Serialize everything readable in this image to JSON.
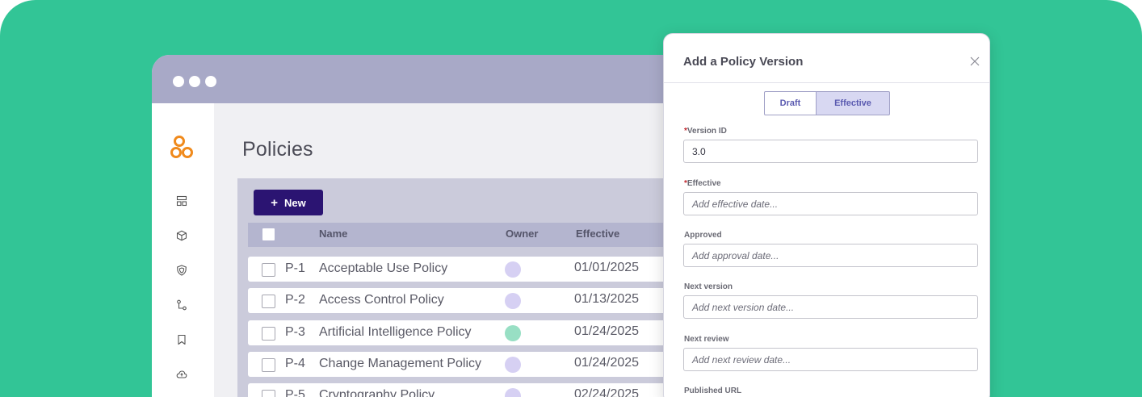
{
  "app": {
    "page_title": "Policies",
    "new_button_label": "New",
    "new_button_icon": "plus-icon"
  },
  "sidebar": {
    "items": [
      {
        "icon": "dashboard-icon"
      },
      {
        "icon": "cube-icon"
      },
      {
        "icon": "shield-icon"
      },
      {
        "icon": "workflow-icon"
      },
      {
        "icon": "bookmark-icon"
      },
      {
        "icon": "cloud-icon"
      }
    ]
  },
  "table": {
    "headers": {
      "name": "Name",
      "owner": "Owner",
      "effective": "Effective"
    },
    "rows": [
      {
        "id": "P-1",
        "name": "Acceptable Use Policy",
        "owner_color": "#d6d0f3",
        "date": "01/01/2025"
      },
      {
        "id": "P-2",
        "name": "Access Control Policy",
        "owner_color": "#d6d0f3",
        "date": "01/13/2025"
      },
      {
        "id": "P-3",
        "name": "Artificial Intelligence Policy",
        "owner_color": "#98dfc4",
        "date": "01/24/2025"
      },
      {
        "id": "P-4",
        "name": "Change Management Policy",
        "owner_color": "#d6d0f3",
        "date": "01/24/2025"
      },
      {
        "id": "P-5",
        "name": "Cryptography Policy",
        "owner_color": "#d6d0f3",
        "date": "02/24/2025"
      }
    ]
  },
  "modal": {
    "title": "Add a Policy Version",
    "tabs": {
      "draft": "Draft",
      "effective": "Effective",
      "selected": "Effective"
    },
    "fields": {
      "version_id": {
        "label": "Version ID",
        "required": "*",
        "value": "3.0"
      },
      "effective": {
        "label": "Effective",
        "required": "*",
        "placeholder": "Add effective date..."
      },
      "approved": {
        "label": "Approved",
        "placeholder": "Add approval date..."
      },
      "next_version": {
        "label": "Next version",
        "placeholder": "Add next version date..."
      },
      "next_review": {
        "label": "Next review",
        "placeholder": "Add next review date..."
      },
      "published_url": {
        "label": "Published URL"
      }
    }
  },
  "colors": {
    "background": "#32c596",
    "titlebar": "#a8a9c7",
    "accent": "#2b1472",
    "logo": "#f08a1c",
    "selected_tab": "#d8d8f2"
  }
}
